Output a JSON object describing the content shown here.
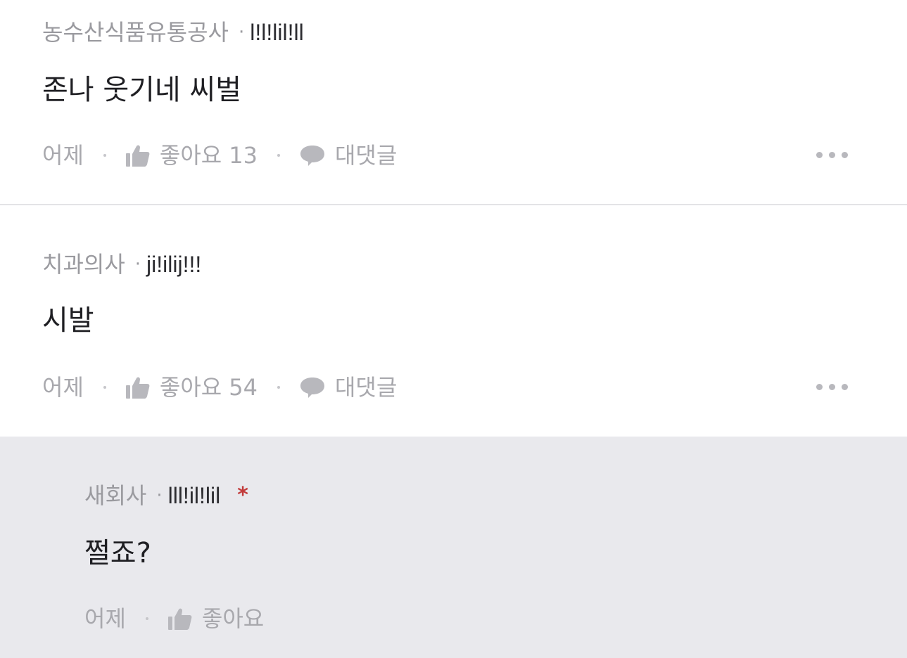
{
  "comments": [
    {
      "company": "농수산식품유통공사",
      "separator": "·",
      "nickname": "l!l!lil!ll",
      "body": "존나 웃기네 씨벌",
      "time": "어제",
      "like_label": "좋아요",
      "like_count": "13",
      "reply_label": "대댓글"
    },
    {
      "company": "치과의사",
      "separator": "·",
      "nickname": "ji!ilij!!!",
      "body": "시발",
      "time": "어제",
      "like_label": "좋아요",
      "like_count": "54",
      "reply_label": "대댓글"
    }
  ],
  "reply": {
    "company": "새회사",
    "separator": "·",
    "nickname": "lll!il!lil",
    "author_mark": "*",
    "body": "쩔죠?",
    "time": "어제",
    "like_label": "좋아요"
  },
  "colors": {
    "reply_background": "#e9e9ed",
    "author_mark": "#c23b3b"
  },
  "icons": [
    "thumbs-up-icon",
    "speech-bubble-icon",
    "more-options-icon"
  ]
}
